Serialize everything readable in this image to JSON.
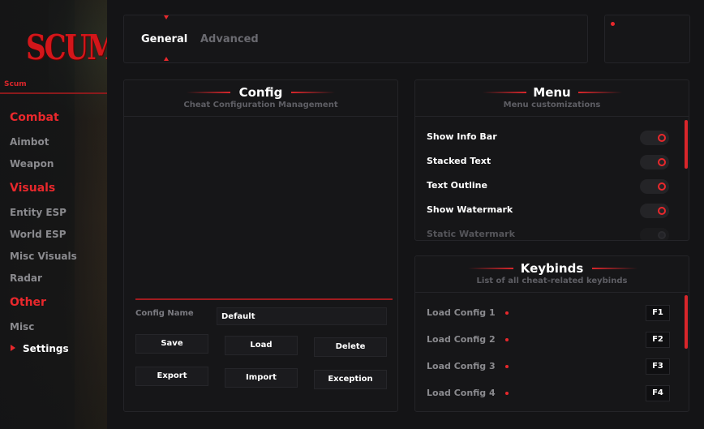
{
  "brand": {
    "logo_text": "SCUM",
    "label": "Scum"
  },
  "sidebar": {
    "categories": [
      {
        "label": "Combat",
        "items": [
          "Aimbot",
          "Weapon"
        ]
      },
      {
        "label": "Visuals",
        "items": [
          "Entity ESP",
          "World ESP",
          "Misc Visuals",
          "Radar"
        ]
      },
      {
        "label": "Other",
        "items": [
          "Misc",
          "Settings"
        ]
      }
    ],
    "active_item": "Settings"
  },
  "tabs": {
    "general": "General",
    "advanced": "Advanced",
    "active": "General"
  },
  "config": {
    "title": "Config",
    "subtitle": "Cheat Configuration Management",
    "name_label": "Config Name",
    "name_value": "Default",
    "buttons": {
      "save": "Save",
      "load": "Load",
      "delete": "Delete",
      "export": "Export",
      "import": "Import",
      "exception": "Exception"
    }
  },
  "menu": {
    "title": "Menu",
    "subtitle": "Menu customizations",
    "options": [
      {
        "label": "Show Info Bar",
        "enabled": true
      },
      {
        "label": "Stacked Text",
        "enabled": true
      },
      {
        "label": "Text Outline",
        "enabled": true
      },
      {
        "label": "Show Watermark",
        "enabled": true
      },
      {
        "label": "Static Watermark",
        "enabled": false
      }
    ]
  },
  "keybinds": {
    "title": "Keybinds",
    "subtitle": "List of all cheat-related keybinds",
    "items": [
      {
        "label": "Load Config 1",
        "key": "F1"
      },
      {
        "label": "Load Config 2",
        "key": "F2"
      },
      {
        "label": "Load Config 3",
        "key": "F3"
      },
      {
        "label": "Load Config 4",
        "key": "F4"
      }
    ]
  },
  "colors": {
    "accent": "#e8282c",
    "background": "#141416",
    "panel": "#161618",
    "muted_text": "#8a8a8e"
  }
}
